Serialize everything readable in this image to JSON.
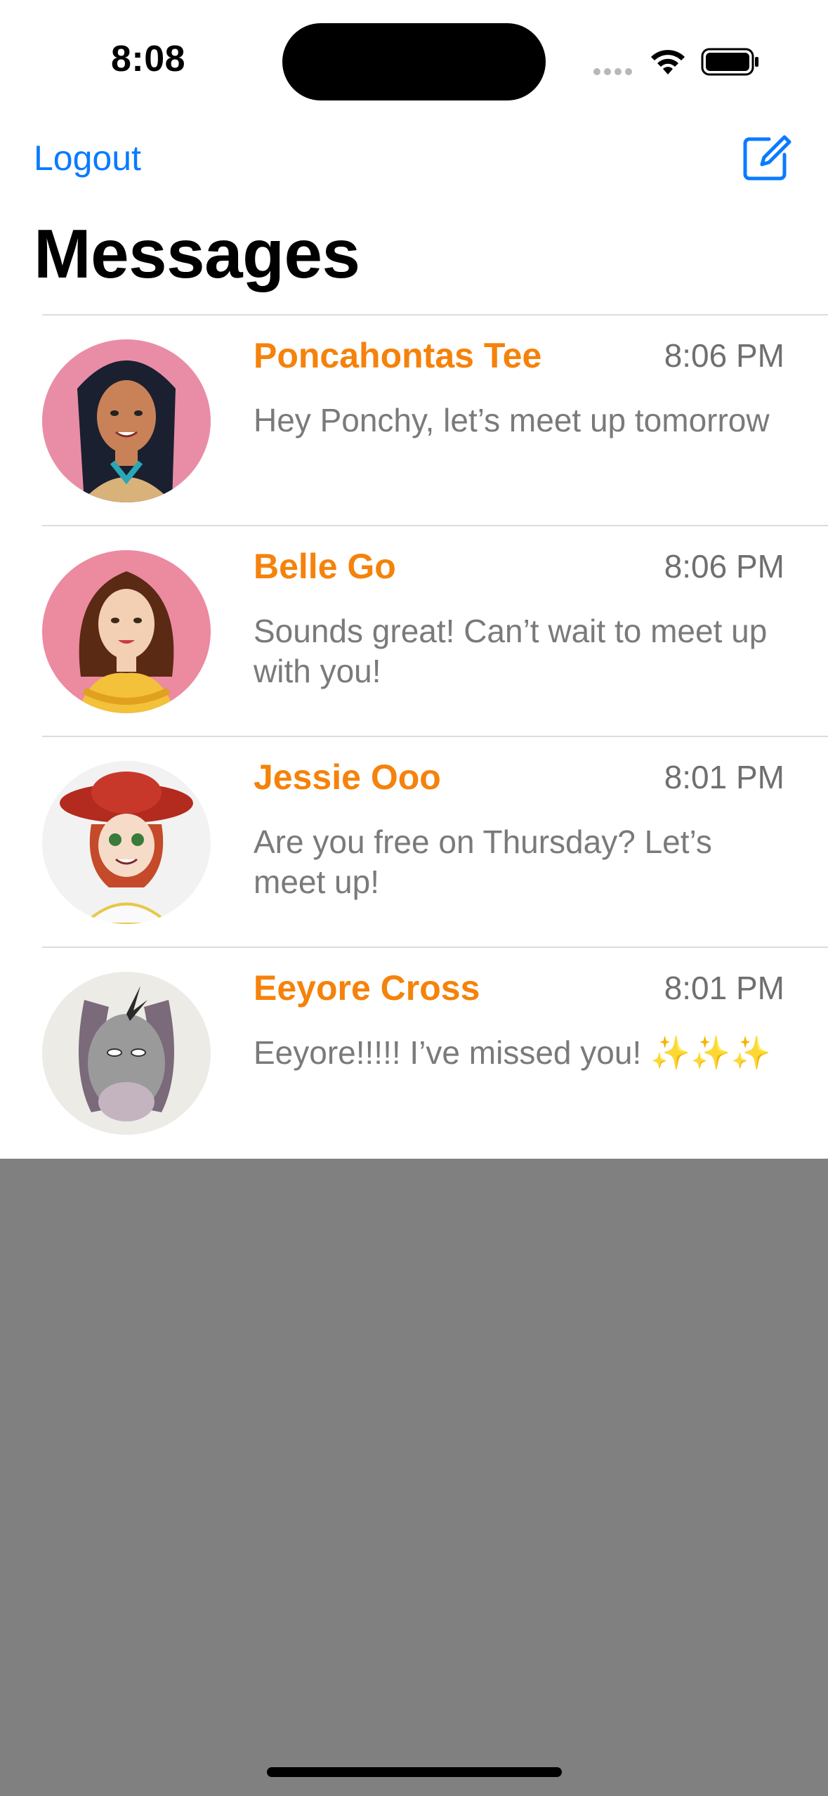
{
  "status_bar": {
    "time": "8:08"
  },
  "nav": {
    "logout_label": "Logout",
    "compose_icon": "compose-icon",
    "title": "Messages"
  },
  "colors": {
    "accent_blue": "#0a7bff",
    "name_orange": "#f5820a",
    "preview_gray": "#7a7a7a",
    "overlay_gray": "#808080"
  },
  "conversations": [
    {
      "name": "Poncahontas Tee",
      "time": "8:06 PM",
      "preview": "Hey Ponchy, let’s meet up tomorrow",
      "avatar": "pocahontas-avatar"
    },
    {
      "name": "Belle Go",
      "time": "8:06 PM",
      "preview": "Sounds great! Can’t wait to meet up with you!",
      "avatar": "belle-avatar"
    },
    {
      "name": "Jessie Ooo",
      "time": "8:01 PM",
      "preview": "Are you free on Thursday? Let’s meet up!",
      "avatar": "jessie-avatar"
    },
    {
      "name": "Eeyore Cross",
      "time": "8:01 PM",
      "preview": "Eeyore!!!!! I’ve missed you! ✨✨✨",
      "avatar": "eeyore-avatar"
    }
  ]
}
